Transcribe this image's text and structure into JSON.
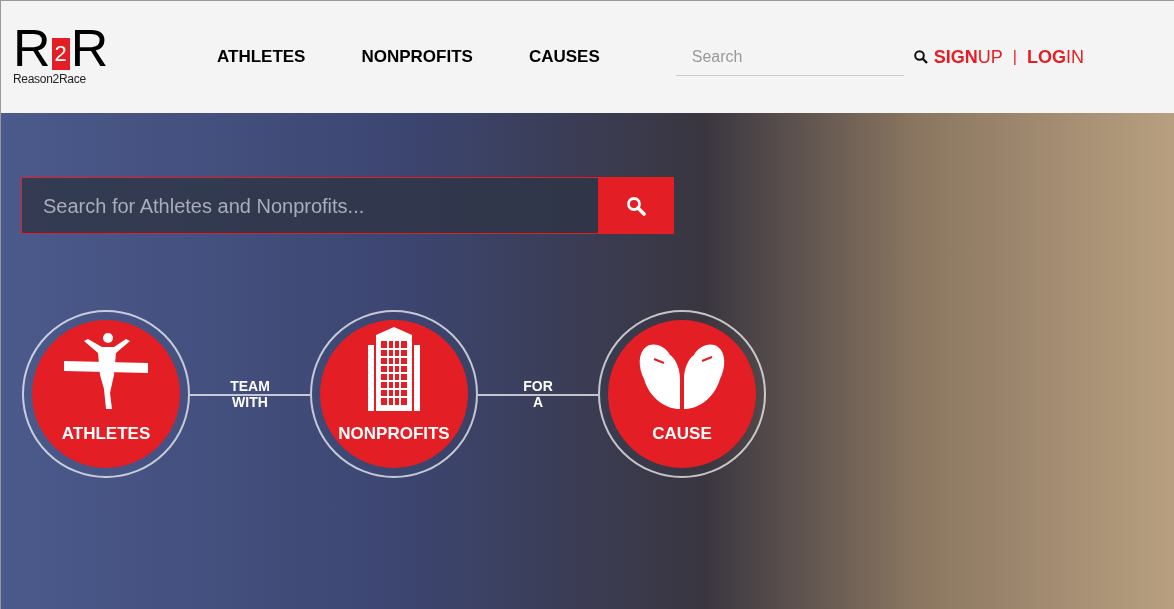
{
  "logo": {
    "left": "R",
    "number": "2",
    "right": "R",
    "name": "Reason2Race"
  },
  "nav": [
    {
      "label": "ATHLETES"
    },
    {
      "label": "NONPROFITS"
    },
    {
      "label": "CAUSES"
    }
  ],
  "header_search": {
    "placeholder": "Search"
  },
  "account": [
    {
      "label": "**SIGN**UP"
    },
    {
      "label": "**LOG**IN"
    }
  ],
  "account_separator": "|",
  "hero_search": {
    "placeholder": "Search for Athletes and Nonprofits..."
  },
  "steps": [
    {
      "kind": "runner",
      "label": "ATHLETES",
      "connector": "TEAM WITH"
    },
    {
      "kind": "building",
      "label": "NONPROFITS",
      "connector": "FOR A"
    },
    {
      "kind": "hands",
      "label": "CAUSE"
    }
  ]
}
